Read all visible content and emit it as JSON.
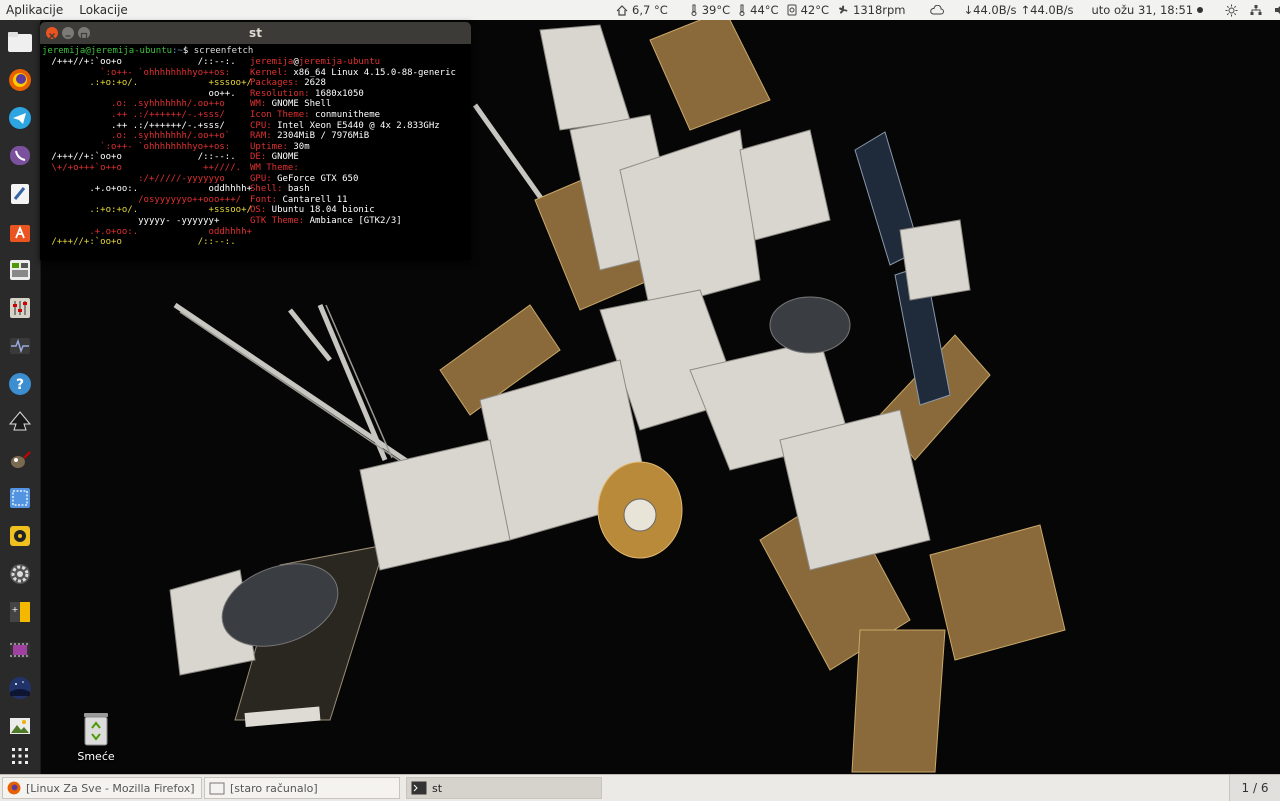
{
  "top_panel": {
    "menus": [
      "Aplikacije",
      "Lokacije"
    ],
    "weather": "6,7 °C",
    "temp1": "39°C",
    "temp2": "44°C",
    "temp3": "42°C",
    "fan": "1318rpm",
    "net_down": "↓44.0B/s",
    "net_up": "↑44.0B/s",
    "clock": "uto ožu 31, 18:51"
  },
  "terminal": {
    "title": "st",
    "command_prompt": "jeremija@jeremija-ubuntu",
    "command_path": ":~",
    "command_symbol": "$",
    "command": " screenfetch",
    "logo_lines": [
      " /+++//+:`oo+o              /::--:.",
      "          `:o++- `ohhhhhhhhyo++os:",
      "        .:+o:+o/.             +sssoo+/",
      "                              oo++.",
      "            .o: .syhhhhhhh/.oo++o",
      "            .++ .:/++++++/-.+sss/",
      "            .++ .:/++++++/-.+sss/",
      "            .o: .syhhhhhhh/.oo++o`",
      "          `:o++- `ohhhhhhhhyo++os:",
      " /+++//+:`oo+o              /::--:.",
      " \\+/+o+++`o++o               ++////.",
      "                 :/+/////-yyyyyyo",
      "        .+.o+oo:.             oddhhhh+",
      "                 /osyyyyyyo++ooo+++/",
      "        .:+o:+o/.             +sssoo+/",
      "                 yyyyy- -yyyyyy+",
      "        .+.o+oo:.             oddhhhh+",
      " /+++//+:`oo+o              /::--:."
    ],
    "info": [
      {
        "label": "",
        "value": ""
      },
      {
        "label": "Kernel:",
        "value": " x86_64 Linux 4.15.0-88-generic"
      },
      {
        "label": "Packages:",
        "value": " 2628"
      },
      {
        "label": "Resolution:",
        "value": " 1680x1050"
      },
      {
        "label": "WM:",
        "value": " GNOME Shell"
      },
      {
        "label": "Icon Theme:",
        "value": " conmunitheme"
      },
      {
        "label": "CPU:",
        "value": " Intel Xeon E5440 @ 4x 2.833GHz"
      },
      {
        "label": "RAM:",
        "value": " 2304MiB / 7976MiB"
      },
      {
        "label": "Uptime:",
        "value": " 30m"
      },
      {
        "label": "DE:",
        "value": " GNOME"
      },
      {
        "label": "WM Theme:",
        "value": ""
      },
      {
        "label": "GPU:",
        "value": " GeForce GTX 650"
      },
      {
        "label": "Shell:",
        "value": " bash"
      },
      {
        "label": "Font:",
        "value": " Cantarell 11"
      },
      {
        "label": "OS:",
        "value": " Ubuntu 18.04 bionic"
      },
      {
        "label": "GTK Theme:",
        "value": " Ambiance [GTK2/3]"
      }
    ],
    "user_host_user": "jeremija",
    "user_host_at": "@",
    "user_host_host": "jeremija-ubuntu"
  },
  "desktop": {
    "trash_label": "Smeće"
  },
  "taskbar": {
    "tasks": [
      "[Linux Za Sve - Mozilla Firefox]",
      "[staro računalo]",
      "st"
    ],
    "workspace": "1 / 6"
  }
}
